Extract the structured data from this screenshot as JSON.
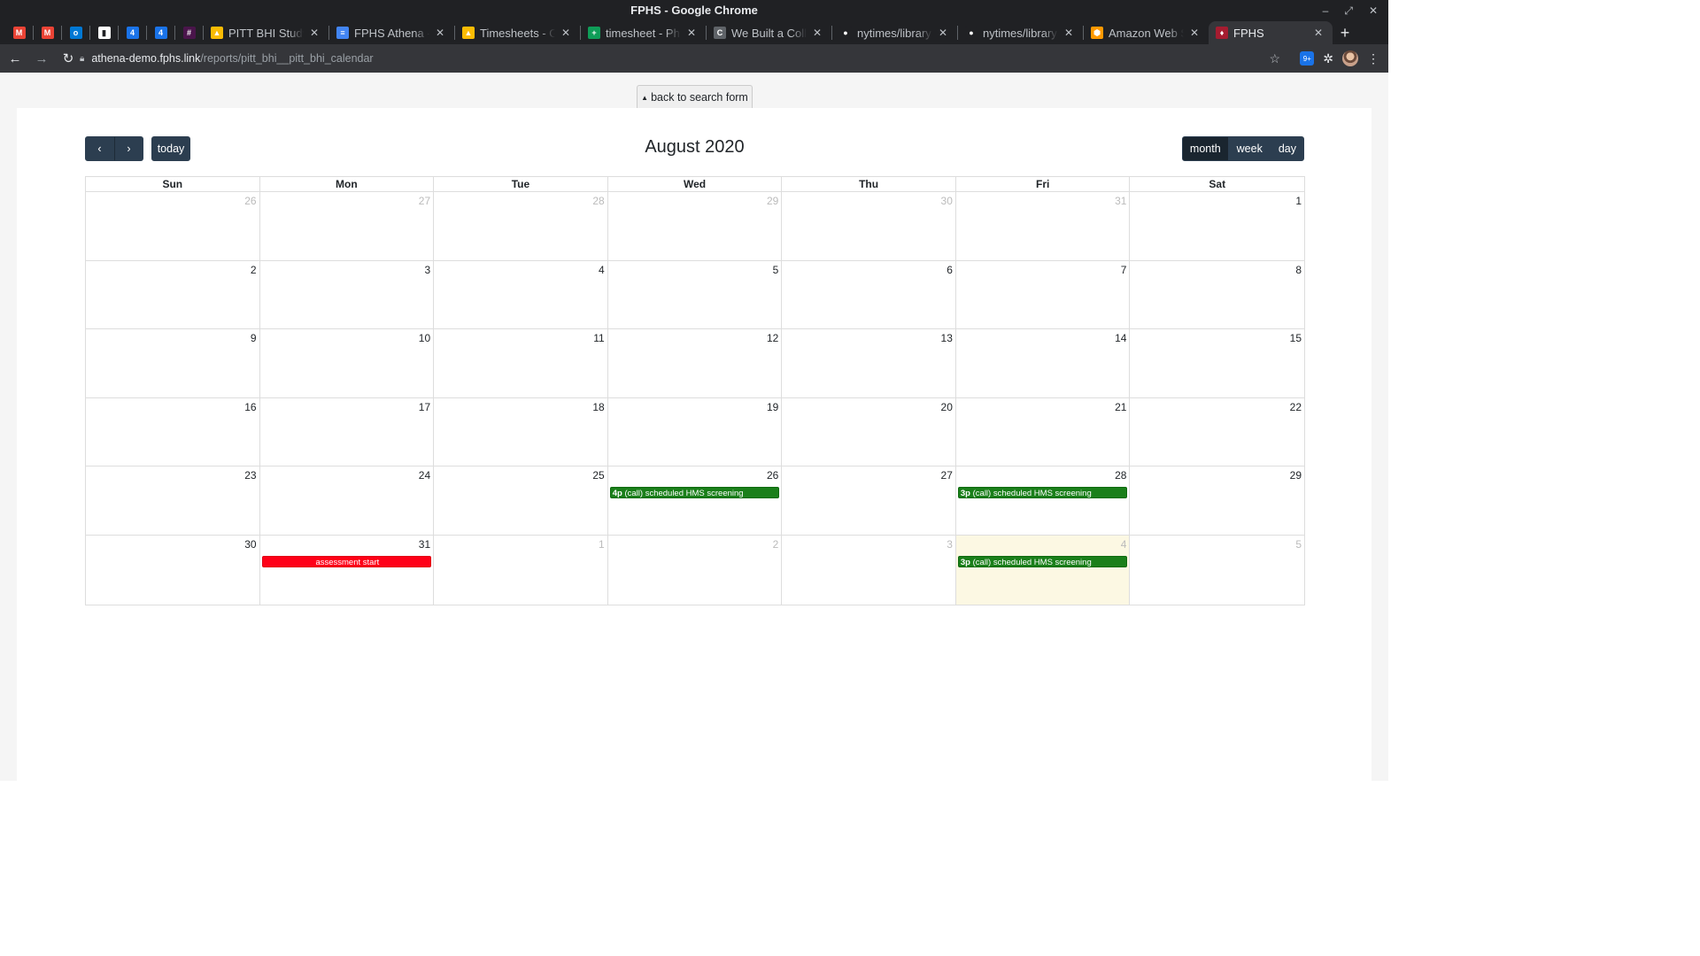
{
  "window": {
    "title": "FPHS - Google Chrome"
  },
  "tabs": [
    {
      "kind": "pinned",
      "icon": "gmail-icon",
      "color": "#ea4335",
      "glyph": "M"
    },
    {
      "kind": "pinned",
      "icon": "gmail-icon",
      "color": "#ea4335",
      "glyph": "M"
    },
    {
      "kind": "pinned",
      "icon": "outlook-icon",
      "color": "#0078d4",
      "glyph": "o"
    },
    {
      "kind": "pinned",
      "icon": "trello-icon",
      "color": "#ffffff",
      "glyph": "▮"
    },
    {
      "kind": "pinned",
      "icon": "calendar-icon",
      "color": "#1a73e8",
      "glyph": "4"
    },
    {
      "kind": "pinned",
      "icon": "calendar-icon",
      "color": "#1a73e8",
      "glyph": "4"
    },
    {
      "kind": "pinned",
      "icon": "slack-icon",
      "color": "#4a154b",
      "glyph": "#"
    },
    {
      "kind": "normal",
      "icon": "google-drive-icon",
      "color": "#fbbc04",
      "glyph": "▲",
      "label": "PITT BHI Study -"
    },
    {
      "kind": "normal",
      "icon": "google-docs-icon",
      "color": "#4285f4",
      "glyph": "≡",
      "label": "FPHS Athena - F"
    },
    {
      "kind": "normal",
      "icon": "google-drive-icon",
      "color": "#fbbc04",
      "glyph": "▲",
      "label": "Timesheets - Go"
    },
    {
      "kind": "normal",
      "icon": "google-sheets-icon",
      "color": "#0f9d58",
      "glyph": "+",
      "label": "timesheet - Phil"
    },
    {
      "kind": "normal",
      "icon": "blog-icon",
      "color": "#5f6368",
      "glyph": "C",
      "label": "We Built a Colla"
    },
    {
      "kind": "normal",
      "icon": "github-icon",
      "color": "#202124",
      "glyph": "●",
      "label": "nytimes/library"
    },
    {
      "kind": "normal",
      "icon": "github-icon",
      "color": "#202124",
      "glyph": "●",
      "label": "nytimes/library"
    },
    {
      "kind": "normal",
      "icon": "aws-icon",
      "color": "#ff9900",
      "glyph": "⬢",
      "label": "Amazon Web Se"
    },
    {
      "kind": "active",
      "icon": "harvard-shield-icon",
      "color": "#a51c30",
      "glyph": "♦",
      "label": "FPHS"
    }
  ],
  "address_bar": {
    "domain": "athena-demo.fphs.link",
    "path": "/reports/pitt_bhi__pitt_bhi_calendar"
  },
  "extension_badge": "9+",
  "page": {
    "back_button": "back to search form"
  },
  "calendar": {
    "title": "August 2020",
    "today_button": "today",
    "view_modes": [
      "month",
      "week",
      "day"
    ],
    "active_view": "month",
    "weekdays": [
      "Sun",
      "Mon",
      "Tue",
      "Wed",
      "Thu",
      "Fri",
      "Sat"
    ],
    "weeks": [
      [
        {
          "d": "26",
          "other": true
        },
        {
          "d": "27",
          "other": true
        },
        {
          "d": "28",
          "other": true
        },
        {
          "d": "29",
          "other": true
        },
        {
          "d": "30",
          "other": true
        },
        {
          "d": "31",
          "other": true
        },
        {
          "d": "1"
        }
      ],
      [
        {
          "d": "2"
        },
        {
          "d": "3"
        },
        {
          "d": "4"
        },
        {
          "d": "5"
        },
        {
          "d": "6"
        },
        {
          "d": "7"
        },
        {
          "d": "8"
        }
      ],
      [
        {
          "d": "9"
        },
        {
          "d": "10"
        },
        {
          "d": "11"
        },
        {
          "d": "12"
        },
        {
          "d": "13"
        },
        {
          "d": "14"
        },
        {
          "d": "15"
        }
      ],
      [
        {
          "d": "16"
        },
        {
          "d": "17"
        },
        {
          "d": "18"
        },
        {
          "d": "19"
        },
        {
          "d": "20"
        },
        {
          "d": "21"
        },
        {
          "d": "22"
        }
      ],
      [
        {
          "d": "23"
        },
        {
          "d": "24"
        },
        {
          "d": "25"
        },
        {
          "d": "26",
          "event": {
            "time": "4p",
            "title": "(call) scheduled HMS screening",
            "color": "green"
          }
        },
        {
          "d": "27"
        },
        {
          "d": "28",
          "event": {
            "time": "3p",
            "title": "(call) scheduled HMS screening",
            "color": "green"
          }
        },
        {
          "d": "29"
        }
      ],
      [
        {
          "d": "30"
        },
        {
          "d": "31",
          "event": {
            "time": "",
            "title": "assessment start",
            "color": "red"
          }
        },
        {
          "d": "1",
          "other": true
        },
        {
          "d": "2",
          "other": true
        },
        {
          "d": "3",
          "other": true
        },
        {
          "d": "4",
          "other": true,
          "today": true,
          "event": {
            "time": "3p",
            "title": "(call) scheduled HMS screening",
            "color": "green"
          }
        },
        {
          "d": "5",
          "other": true
        }
      ]
    ]
  }
}
